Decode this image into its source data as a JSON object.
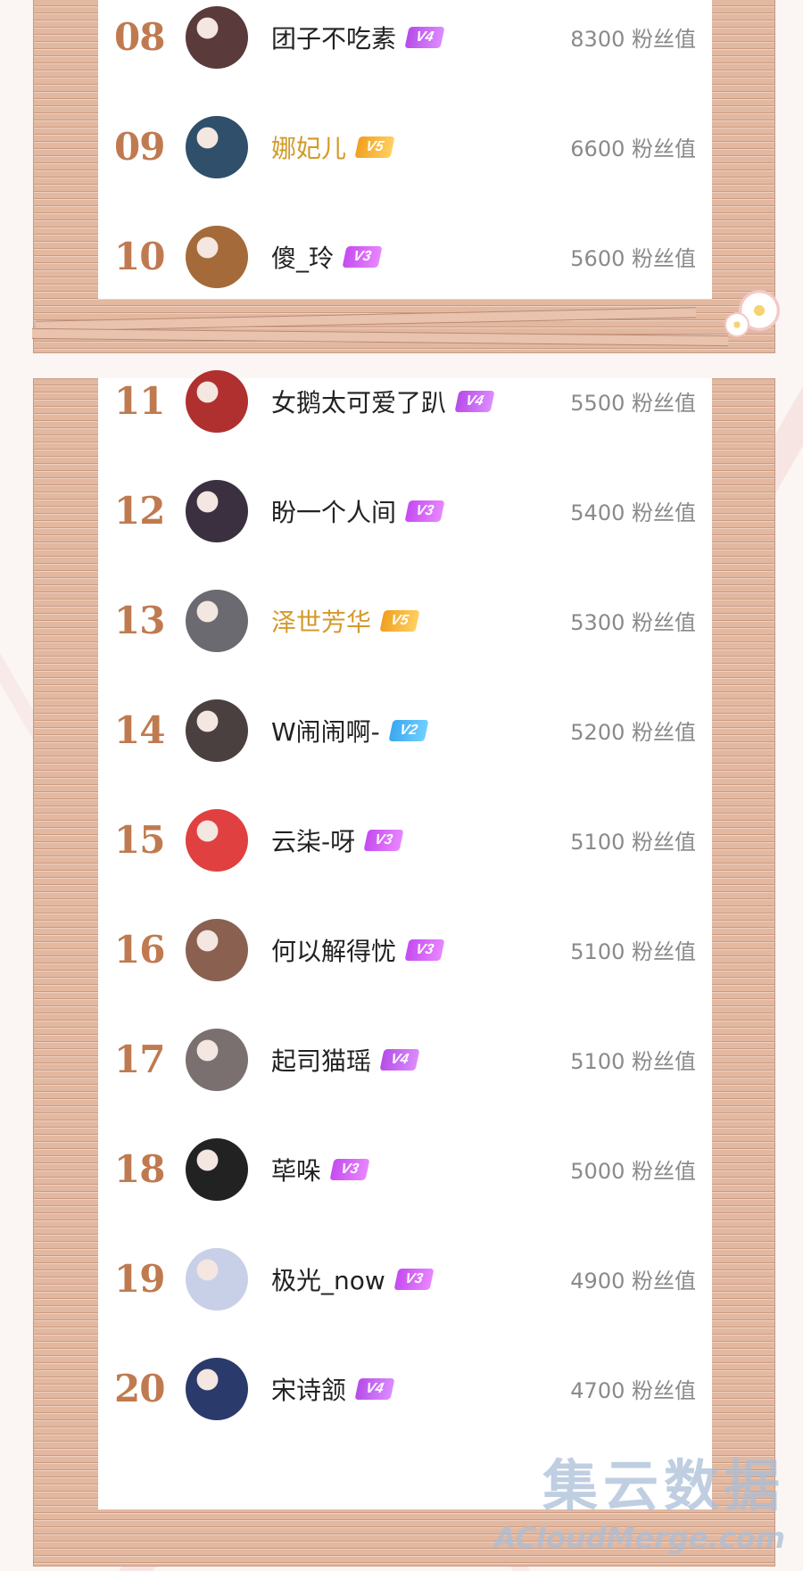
{
  "ranking": {
    "top_rows": [
      {
        "rank": "08",
        "name": "团子不吃素",
        "badge": "V4",
        "badge_level": "v4",
        "score": "8300 粉丝值",
        "highlight": false,
        "avatar_color": "#5a3a3a"
      },
      {
        "rank": "09",
        "name": "娜妃儿",
        "badge": "V5",
        "badge_level": "v5",
        "score": "6600 粉丝值",
        "highlight": true,
        "avatar_color": "#2f4f6a"
      },
      {
        "rank": "10",
        "name": "傻_玲",
        "badge": "V3",
        "badge_level": "v3",
        "score": "5600 粉丝值",
        "highlight": false,
        "avatar_color": "#a46a3a"
      }
    ],
    "bottom_rows": [
      {
        "rank": "11",
        "name": "女鹅太可爱了趴",
        "badge": "V4",
        "badge_level": "v4",
        "score": "5500 粉丝值",
        "highlight": false,
        "avatar_color": "#b03030"
      },
      {
        "rank": "12",
        "name": "盼一个人间",
        "badge": "V3",
        "badge_level": "v3",
        "score": "5400 粉丝值",
        "highlight": false,
        "avatar_color": "#3a3040"
      },
      {
        "rank": "13",
        "name": "泽世芳华",
        "badge": "V5",
        "badge_level": "v5",
        "score": "5300 粉丝值",
        "highlight": true,
        "avatar_color": "#6a6a70"
      },
      {
        "rank": "14",
        "name": "W闹闹啊-",
        "badge": "V2",
        "badge_level": "v2",
        "score": "5200 粉丝值",
        "highlight": false,
        "avatar_color": "#4a4040"
      },
      {
        "rank": "15",
        "name": "云柒-呀",
        "badge": "V3",
        "badge_level": "v3",
        "score": "5100 粉丝值",
        "highlight": false,
        "avatar_color": "#e04040"
      },
      {
        "rank": "16",
        "name": "何以解得忧",
        "badge": "V3",
        "badge_level": "v3",
        "score": "5100 粉丝值",
        "highlight": false,
        "avatar_color": "#8a6050"
      },
      {
        "rank": "17",
        "name": "起司猫瑶",
        "badge": "V4",
        "badge_level": "v4",
        "score": "5100 粉丝值",
        "highlight": false,
        "avatar_color": "#7a7070"
      },
      {
        "rank": "18",
        "name": "荜哚",
        "badge": "V3",
        "badge_level": "v3",
        "score": "5000 粉丝值",
        "highlight": false,
        "avatar_color": "#222222"
      },
      {
        "rank": "19",
        "name": "极光_now",
        "badge": "V3",
        "badge_level": "v3",
        "score": "4900 粉丝值",
        "highlight": false,
        "avatar_color": "#c8d0e8"
      },
      {
        "rank": "20",
        "name": "宋诗颔",
        "badge": "V4",
        "badge_level": "v4",
        "score": "4700 粉丝值",
        "highlight": false,
        "avatar_color": "#2a3a6a"
      }
    ]
  },
  "watermark": {
    "cn": "集云数据",
    "en": "ACloudMerge.com"
  },
  "colors": {
    "rank": "#c07a50",
    "highlight_name": "#d39a2a",
    "score": "#8a8a8a"
  }
}
